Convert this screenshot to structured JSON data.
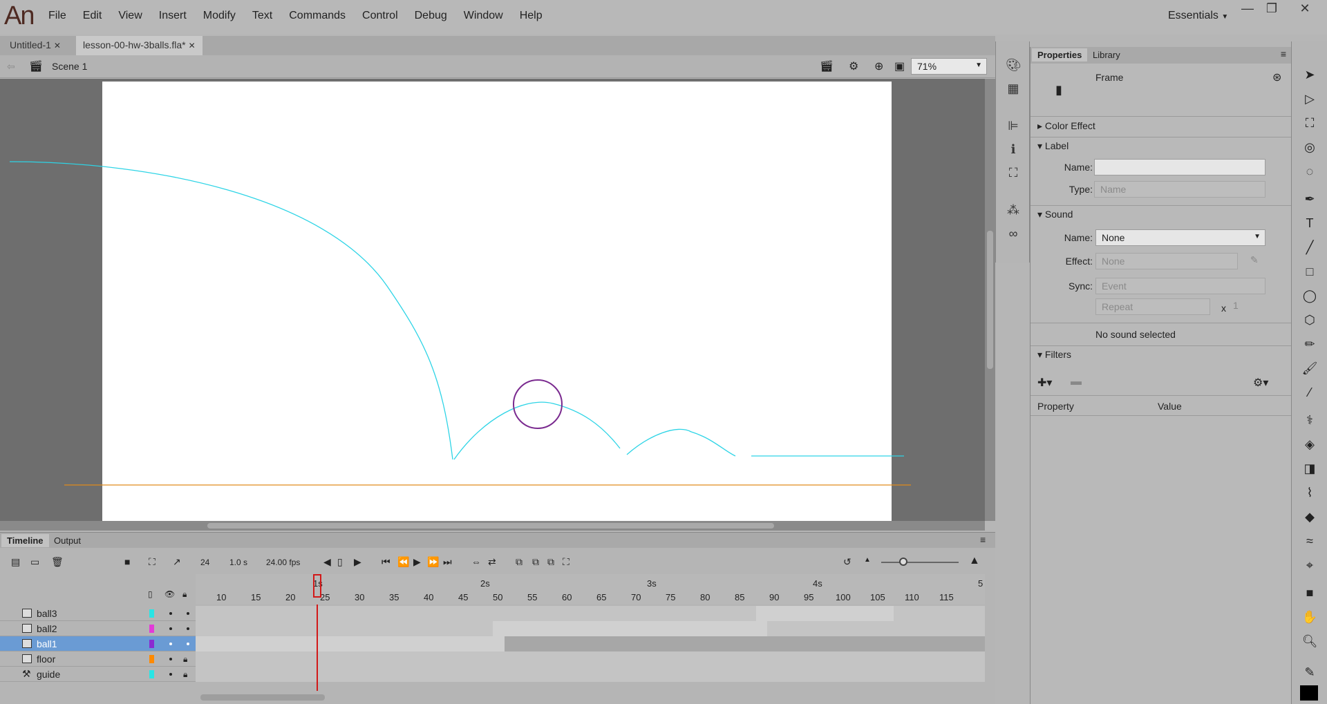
{
  "app": {
    "logo": "An",
    "menus": [
      "File",
      "Edit",
      "View",
      "Insert",
      "Modify",
      "Text",
      "Commands",
      "Control",
      "Debug",
      "Window",
      "Help"
    ],
    "workspace": "Essentials",
    "window_controls": [
      "—",
      "❐",
      "✕"
    ]
  },
  "documents": [
    {
      "label": "Untitled-1",
      "close": "✕"
    },
    {
      "label": "lesson-00-hw-3balls.fla*",
      "close": "✕"
    }
  ],
  "editbar": {
    "scene": "Scene 1",
    "zoom": "71%"
  },
  "colors": {
    "accent_selection": "#6a9bd4",
    "path": "#2dd4e6",
    "floor": "#e08a1a",
    "ball": "#7a2a8f",
    "playhead": "#d21818"
  },
  "timeline": {
    "tabs": [
      "Timeline",
      "Output"
    ],
    "fps_field": "24",
    "time_field": "1.0 s",
    "fps_rate": "24.00 fps",
    "frame_numbers": [
      "10",
      "15",
      "20",
      "25",
      "30",
      "35",
      "40",
      "45",
      "50",
      "55",
      "60",
      "65",
      "70",
      "75",
      "80",
      "85",
      "90",
      "95",
      "100",
      "105",
      "110",
      "115"
    ],
    "second_markers": [
      "1s",
      "2s",
      "3s",
      "4s",
      "5"
    ],
    "layers": [
      {
        "name": "ball3",
        "color": "#29e5e5"
      },
      {
        "name": "ball2",
        "color": "#e23bd9"
      },
      {
        "name": "ball1",
        "color": "#8a2bd1"
      },
      {
        "name": "floor",
        "color": "#ff8a00"
      },
      {
        "name": "guide",
        "color": "#29e5e5"
      }
    ],
    "selected_layer": "ball1"
  },
  "properties": {
    "tabs": [
      "Properties",
      "Library"
    ],
    "object_type": "Frame",
    "sections": {
      "color_effect": "Color Effect",
      "label": "Label",
      "sound": "Sound",
      "filters": "Filters"
    },
    "label_name_label": "Name:",
    "label_name_value": "",
    "label_type_label": "Type:",
    "label_type_value": "Name",
    "sound_name_label": "Name:",
    "sound_name_value": "None",
    "effect_label": "Effect:",
    "effect_value": "None",
    "sync_label": "Sync:",
    "sync_value": "Event",
    "repeat_value": "Repeat",
    "repeat_x": "x",
    "repeat_count": "1",
    "no_sound": "No sound selected",
    "filter_columns": [
      "Property",
      "Value"
    ]
  }
}
